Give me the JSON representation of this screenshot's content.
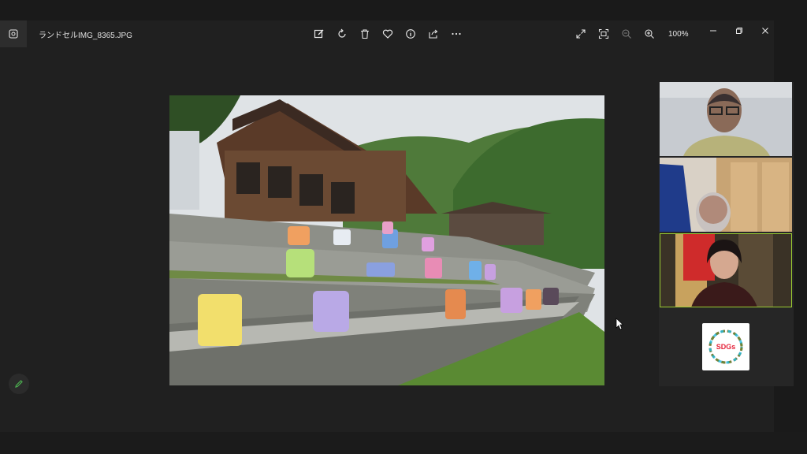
{
  "window": {
    "filename": "ランドセルIMG_8365.JPG",
    "zoom_label": "100%"
  },
  "toolbar": {
    "edit": "edit-icon",
    "rotate": "rotate-icon",
    "delete": "trash-icon",
    "favorite": "heart-icon",
    "info": "info-icon",
    "share": "share-icon",
    "more": "more-icon"
  },
  "view_tools": [
    "expand-icon",
    "fit-icon",
    "zoom-out-icon",
    "zoom-in-icon"
  ],
  "window_controls": [
    "minimize-icon",
    "restore-icon",
    "close-icon"
  ],
  "photo": {
    "subject": "Colorful school backpacks on stone terraces in front of a wooden building",
    "bag_colors": [
      "#f2df6c",
      "#b9a9e6",
      "#e58a4f",
      "#b6e07a",
      "#e88cb5",
      "#c7a0e0",
      "#f0a060",
      "#8aa0e0",
      "#6fb0e8",
      "#5a4a5a"
    ]
  },
  "colors": {
    "accent": "#9acd32",
    "edit_fab": "#4caf50"
  },
  "meeting_tiles": [
    {
      "name": "participant-1"
    },
    {
      "name": "participant-2"
    },
    {
      "name": "participant-3",
      "active": true
    },
    {
      "name": "participant-4-sdgs"
    }
  ],
  "sdgs": {
    "logo_text": "SDGs"
  }
}
